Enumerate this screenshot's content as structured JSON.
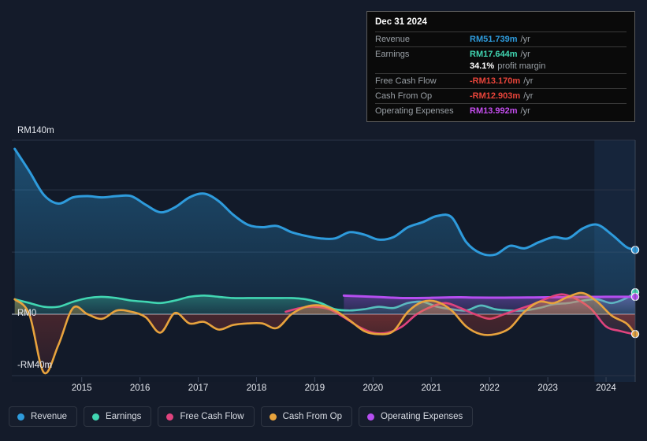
{
  "tooltip": {
    "title": "Dec 31 2024",
    "rows": [
      {
        "label": "Revenue",
        "value": "RM51.739m",
        "unit": "/yr",
        "color": "#2e9bdc"
      },
      {
        "label": "Earnings",
        "value": "RM17.644m",
        "unit": "/yr",
        "color": "#41d6b2"
      },
      {
        "label": "",
        "value": "34.1%",
        "unit": "profit margin",
        "color": "#ffffff"
      },
      {
        "label": "Free Cash Flow",
        "value": "-RM13.170m",
        "unit": "/yr",
        "color": "#e8443a"
      },
      {
        "label": "Cash From Op",
        "value": "-RM12.903m",
        "unit": "/yr",
        "color": "#e8443a"
      },
      {
        "label": "Operating Expenses",
        "value": "RM13.992m",
        "unit": "/yr",
        "color": "#c64ef0"
      }
    ]
  },
  "axis": {
    "y_top_label": "RM140m",
    "y_zero_label": "RM0",
    "y_bottom_label": "-RM40m",
    "x_ticks": [
      "2015",
      "2016",
      "2017",
      "2018",
      "2019",
      "2020",
      "2021",
      "2022",
      "2023",
      "2024"
    ]
  },
  "legend": [
    {
      "label": "Revenue",
      "color": "#2e9bdc"
    },
    {
      "label": "Earnings",
      "color": "#41d6b2"
    },
    {
      "label": "Free Cash Flow",
      "color": "#e0437e"
    },
    {
      "label": "Cash From Op",
      "color": "#e8a33d"
    },
    {
      "label": "Operating Expenses",
      "color": "#b54ef0"
    }
  ],
  "chart_data": {
    "type": "area",
    "title": "",
    "xlabel": "",
    "ylabel": "RM",
    "ylim": [
      -40,
      140
    ],
    "xlim": [
      2014.3,
      2025.0
    ],
    "grid": true,
    "legend_position": "bottom",
    "currency": "RM",
    "units": "millions",
    "y_gridlines": [
      140,
      100,
      50,
      0,
      -40
    ],
    "highlight_band": {
      "from": 2024.3,
      "to": 2025.0
    },
    "series": [
      {
        "name": "Revenue",
        "color": "#2e9bdc",
        "x": [
          2014.35,
          2014.6,
          2014.85,
          2015.1,
          2015.35,
          2015.6,
          2015.85,
          2016.1,
          2016.35,
          2016.6,
          2016.85,
          2017.1,
          2017.35,
          2017.6,
          2017.85,
          2018.1,
          2018.35,
          2018.6,
          2018.85,
          2019.1,
          2019.35,
          2019.6,
          2019.85,
          2020.1,
          2020.35,
          2020.6,
          2020.85,
          2021.1,
          2021.35,
          2021.6,
          2021.85,
          2022.1,
          2022.35,
          2022.6,
          2022.85,
          2023.1,
          2023.35,
          2023.6,
          2023.85,
          2024.1,
          2024.35,
          2024.6,
          2024.85,
          2025.0
        ],
        "y": [
          133,
          115,
          96,
          89,
          94,
          95,
          94,
          95,
          95,
          88,
          82,
          86,
          94,
          97,
          91,
          80,
          72,
          70,
          71,
          66,
          63,
          61,
          61,
          66,
          64,
          60,
          62,
          70,
          74,
          79,
          78,
          58,
          49,
          48,
          55,
          53,
          58,
          62,
          61,
          69,
          72,
          64,
          54,
          52
        ]
      },
      {
        "name": "Earnings",
        "color": "#41d6b2",
        "x": [
          2014.35,
          2014.6,
          2014.85,
          2015.1,
          2015.35,
          2015.6,
          2015.85,
          2016.1,
          2016.35,
          2016.6,
          2016.85,
          2017.1,
          2017.35,
          2017.6,
          2017.85,
          2018.1,
          2018.35,
          2018.6,
          2018.85,
          2019.1,
          2019.35,
          2019.6,
          2019.85,
          2020.1,
          2020.35,
          2020.6,
          2020.85,
          2021.1,
          2021.35,
          2021.6,
          2021.85,
          2022.1,
          2022.35,
          2022.6,
          2022.85,
          2023.1,
          2023.35,
          2023.6,
          2023.85,
          2024.1,
          2024.35,
          2024.6,
          2024.85,
          2025.0
        ],
        "y": [
          12,
          9,
          6,
          6,
          10,
          13,
          14,
          13,
          11,
          10,
          9,
          11,
          14,
          15,
          14,
          13,
          13,
          13,
          13,
          13,
          12,
          9,
          4,
          3,
          4,
          6,
          5,
          9,
          10,
          6,
          4,
          3,
          7,
          4,
          3,
          3,
          5,
          8,
          9,
          11,
          12,
          9,
          13,
          17.6
        ]
      },
      {
        "name": "Free Cash Flow",
        "color": "#e0437e",
        "x": [
          2019.0,
          2019.25,
          2019.5,
          2019.75,
          2020.0,
          2020.25,
          2020.5,
          2020.75,
          2021.0,
          2021.25,
          2021.5,
          2021.75,
          2022.0,
          2022.25,
          2022.5,
          2022.75,
          2023.0,
          2023.25,
          2023.5,
          2023.75,
          2024.0,
          2024.25,
          2024.5,
          2024.75,
          2025.0
        ],
        "y": [
          2,
          5,
          6,
          4,
          -2,
          -8,
          -12,
          -12,
          -8,
          0,
          6,
          9,
          5,
          0,
          -3,
          0,
          4,
          8,
          13,
          16,
          12,
          4,
          -8,
          -11,
          -13.2
        ]
      },
      {
        "name": "Cash From Op",
        "color": "#e8a33d",
        "x": [
          2014.35,
          2014.6,
          2014.85,
          2015.1,
          2015.35,
          2015.6,
          2015.85,
          2016.1,
          2016.35,
          2016.6,
          2016.85,
          2017.1,
          2017.35,
          2017.6,
          2017.85,
          2018.1,
          2018.35,
          2018.6,
          2018.85,
          2019.1,
          2019.35,
          2019.6,
          2019.85,
          2020.1,
          2020.35,
          2020.6,
          2020.85,
          2021.1,
          2021.35,
          2021.6,
          2021.85,
          2022.1,
          2022.35,
          2022.6,
          2022.85,
          2023.1,
          2023.35,
          2023.6,
          2023.85,
          2024.1,
          2024.35,
          2024.6,
          2024.85,
          2025.0
        ],
        "y": [
          12,
          0,
          -38,
          -20,
          5,
          0,
          -3,
          3,
          2,
          -2,
          -12,
          1,
          -6,
          -5,
          -10,
          -7,
          -6,
          -6,
          -9,
          0,
          6,
          7,
          3,
          -4,
          -11,
          -13,
          -11,
          2,
          10,
          10,
          3,
          -8,
          -13,
          -13,
          -9,
          2,
          10,
          9,
          14,
          17,
          10,
          -1,
          -6,
          -12.9
        ]
      },
      {
        "name": "Operating Expenses",
        "color": "#b54ef0",
        "x": [
          2020.0,
          2020.25,
          2020.5,
          2020.75,
          2021.0,
          2021.25,
          2021.5,
          2021.75,
          2022.0,
          2022.25,
          2022.5,
          2022.75,
          2023.0,
          2023.25,
          2023.5,
          2023.75,
          2024.0,
          2024.25,
          2024.5,
          2024.75,
          2025.0
        ],
        "y": [
          15,
          14.5,
          14,
          13.5,
          13,
          13,
          13.2,
          13.5,
          13.6,
          13.4,
          13.3,
          13.3,
          13.4,
          13.5,
          13.6,
          13.7,
          13.8,
          13.9,
          14,
          14,
          13.99
        ]
      }
    ],
    "endpoints": [
      {
        "name": "Revenue",
        "value": 51.739,
        "color": "#2e9bdc"
      },
      {
        "name": "Earnings",
        "value": 17.644,
        "color": "#41d6b2"
      },
      {
        "name": "Operating Expenses",
        "value": 13.992,
        "color": "#b54ef0"
      },
      {
        "name": "Cash From Op",
        "value": -12.903,
        "color": "#e8a33d"
      }
    ]
  }
}
